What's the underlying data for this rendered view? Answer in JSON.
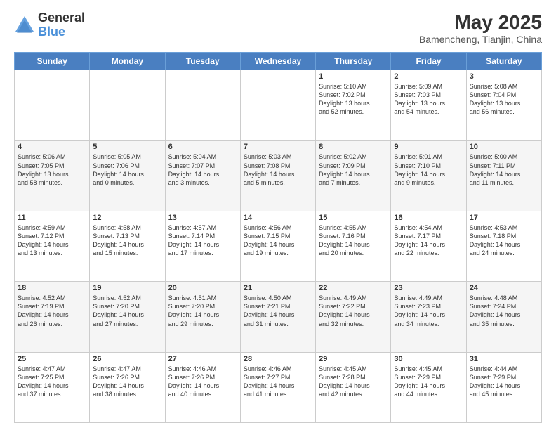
{
  "header": {
    "logo_general": "General",
    "logo_blue": "Blue",
    "month_year": "May 2025",
    "location": "Bamencheng, Tianjin, China"
  },
  "days_of_week": [
    "Sunday",
    "Monday",
    "Tuesday",
    "Wednesday",
    "Thursday",
    "Friday",
    "Saturday"
  ],
  "weeks": [
    {
      "days": [
        {
          "num": "",
          "info": ""
        },
        {
          "num": "",
          "info": ""
        },
        {
          "num": "",
          "info": ""
        },
        {
          "num": "",
          "info": ""
        },
        {
          "num": "1",
          "info": "Sunrise: 5:10 AM\nSunset: 7:02 PM\nDaylight: 13 hours\nand 52 minutes."
        },
        {
          "num": "2",
          "info": "Sunrise: 5:09 AM\nSunset: 7:03 PM\nDaylight: 13 hours\nand 54 minutes."
        },
        {
          "num": "3",
          "info": "Sunrise: 5:08 AM\nSunset: 7:04 PM\nDaylight: 13 hours\nand 56 minutes."
        }
      ]
    },
    {
      "days": [
        {
          "num": "4",
          "info": "Sunrise: 5:06 AM\nSunset: 7:05 PM\nDaylight: 13 hours\nand 58 minutes."
        },
        {
          "num": "5",
          "info": "Sunrise: 5:05 AM\nSunset: 7:06 PM\nDaylight: 14 hours\nand 0 minutes."
        },
        {
          "num": "6",
          "info": "Sunrise: 5:04 AM\nSunset: 7:07 PM\nDaylight: 14 hours\nand 3 minutes."
        },
        {
          "num": "7",
          "info": "Sunrise: 5:03 AM\nSunset: 7:08 PM\nDaylight: 14 hours\nand 5 minutes."
        },
        {
          "num": "8",
          "info": "Sunrise: 5:02 AM\nSunset: 7:09 PM\nDaylight: 14 hours\nand 7 minutes."
        },
        {
          "num": "9",
          "info": "Sunrise: 5:01 AM\nSunset: 7:10 PM\nDaylight: 14 hours\nand 9 minutes."
        },
        {
          "num": "10",
          "info": "Sunrise: 5:00 AM\nSunset: 7:11 PM\nDaylight: 14 hours\nand 11 minutes."
        }
      ]
    },
    {
      "days": [
        {
          "num": "11",
          "info": "Sunrise: 4:59 AM\nSunset: 7:12 PM\nDaylight: 14 hours\nand 13 minutes."
        },
        {
          "num": "12",
          "info": "Sunrise: 4:58 AM\nSunset: 7:13 PM\nDaylight: 14 hours\nand 15 minutes."
        },
        {
          "num": "13",
          "info": "Sunrise: 4:57 AM\nSunset: 7:14 PM\nDaylight: 14 hours\nand 17 minutes."
        },
        {
          "num": "14",
          "info": "Sunrise: 4:56 AM\nSunset: 7:15 PM\nDaylight: 14 hours\nand 19 minutes."
        },
        {
          "num": "15",
          "info": "Sunrise: 4:55 AM\nSunset: 7:16 PM\nDaylight: 14 hours\nand 20 minutes."
        },
        {
          "num": "16",
          "info": "Sunrise: 4:54 AM\nSunset: 7:17 PM\nDaylight: 14 hours\nand 22 minutes."
        },
        {
          "num": "17",
          "info": "Sunrise: 4:53 AM\nSunset: 7:18 PM\nDaylight: 14 hours\nand 24 minutes."
        }
      ]
    },
    {
      "days": [
        {
          "num": "18",
          "info": "Sunrise: 4:52 AM\nSunset: 7:19 PM\nDaylight: 14 hours\nand 26 minutes."
        },
        {
          "num": "19",
          "info": "Sunrise: 4:52 AM\nSunset: 7:20 PM\nDaylight: 14 hours\nand 27 minutes."
        },
        {
          "num": "20",
          "info": "Sunrise: 4:51 AM\nSunset: 7:20 PM\nDaylight: 14 hours\nand 29 minutes."
        },
        {
          "num": "21",
          "info": "Sunrise: 4:50 AM\nSunset: 7:21 PM\nDaylight: 14 hours\nand 31 minutes."
        },
        {
          "num": "22",
          "info": "Sunrise: 4:49 AM\nSunset: 7:22 PM\nDaylight: 14 hours\nand 32 minutes."
        },
        {
          "num": "23",
          "info": "Sunrise: 4:49 AM\nSunset: 7:23 PM\nDaylight: 14 hours\nand 34 minutes."
        },
        {
          "num": "24",
          "info": "Sunrise: 4:48 AM\nSunset: 7:24 PM\nDaylight: 14 hours\nand 35 minutes."
        }
      ]
    },
    {
      "days": [
        {
          "num": "25",
          "info": "Sunrise: 4:47 AM\nSunset: 7:25 PM\nDaylight: 14 hours\nand 37 minutes."
        },
        {
          "num": "26",
          "info": "Sunrise: 4:47 AM\nSunset: 7:26 PM\nDaylight: 14 hours\nand 38 minutes."
        },
        {
          "num": "27",
          "info": "Sunrise: 4:46 AM\nSunset: 7:26 PM\nDaylight: 14 hours\nand 40 minutes."
        },
        {
          "num": "28",
          "info": "Sunrise: 4:46 AM\nSunset: 7:27 PM\nDaylight: 14 hours\nand 41 minutes."
        },
        {
          "num": "29",
          "info": "Sunrise: 4:45 AM\nSunset: 7:28 PM\nDaylight: 14 hours\nand 42 minutes."
        },
        {
          "num": "30",
          "info": "Sunrise: 4:45 AM\nSunset: 7:29 PM\nDaylight: 14 hours\nand 44 minutes."
        },
        {
          "num": "31",
          "info": "Sunrise: 4:44 AM\nSunset: 7:29 PM\nDaylight: 14 hours\nand 45 minutes."
        }
      ]
    }
  ]
}
